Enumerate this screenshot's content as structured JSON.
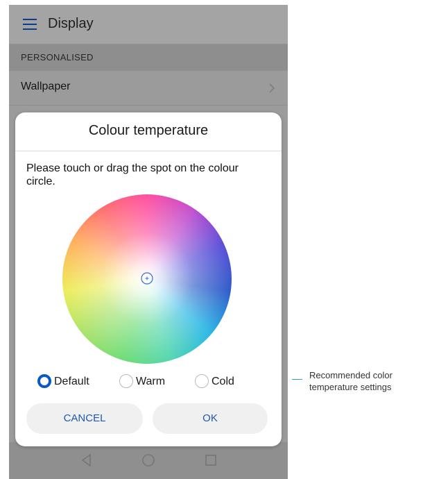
{
  "app_bar": {
    "menu_icon": "hamburger-menu-icon",
    "title": "Display"
  },
  "section_header": "PERSONALISED",
  "list": {
    "wallpaper_label": "Wallpaper",
    "chevron_icon": "chevron-right-icon"
  },
  "dialog": {
    "title": "Colour temperature",
    "message": "Please touch or drag the spot on the colour circle.",
    "options": [
      {
        "label": "Default",
        "selected": true
      },
      {
        "label": "Warm",
        "selected": false
      },
      {
        "label": "Cold",
        "selected": false
      }
    ],
    "cancel_label": "CANCEL",
    "ok_label": "OK"
  },
  "nav_bar": {
    "back_icon": "back-triangle-icon",
    "home_icon": "home-circle-icon",
    "recent_icon": "recent-apps-square-icon"
  },
  "annotation": {
    "text_line1": "Recommended color",
    "text_line2": "temperature settings"
  },
  "colors": {
    "accent": "#0a59c9",
    "button_text": "#1e58b4",
    "callout_line": "#2aa3b8"
  }
}
